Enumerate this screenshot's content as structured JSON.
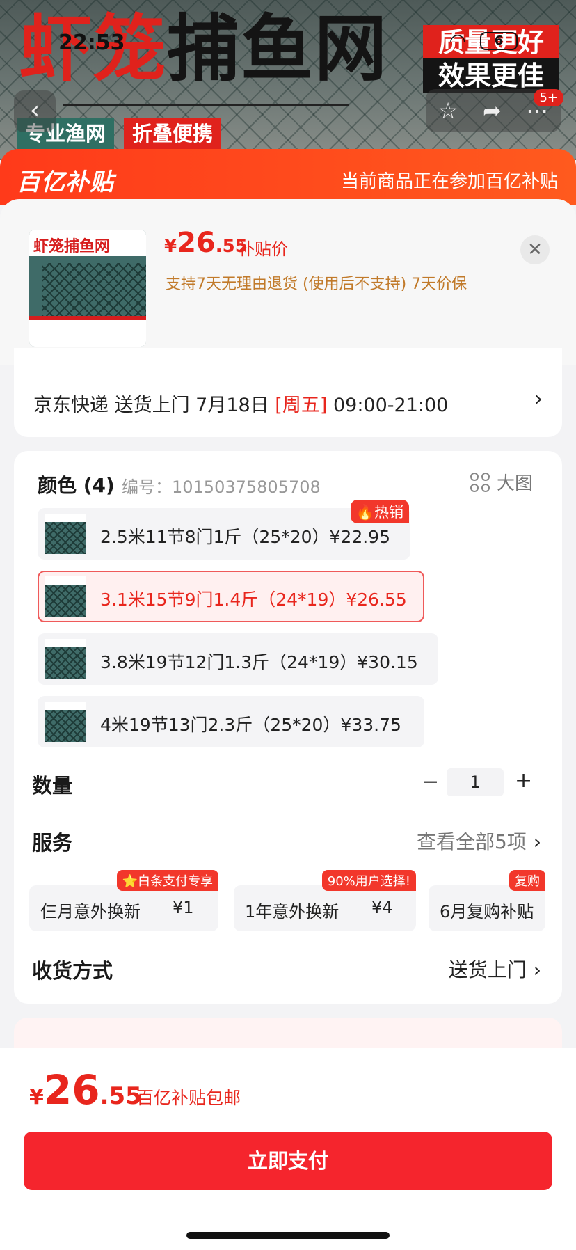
{
  "status_bar": {
    "time": "22:53",
    "battery": "6"
  },
  "hero": {
    "title_red": "虾笼",
    "title_black": "捕鱼网",
    "badge_1": "质量更好",
    "badge_2": "效果更佳",
    "tag_1": "专业渔网",
    "tag_2": "折叠便携",
    "notification_count": "5+"
  },
  "subsidy_bar": {
    "logo": "百亿补贴",
    "note": "当前商品正在参加百亿补贴"
  },
  "product": {
    "price_currency": "¥",
    "price_int": "26",
    "price_dec": ".55",
    "price_label": "补贴价",
    "services": "支持7天无理由退货 (使用后不支持)  7天价保",
    "thumb_title": "虾笼捕鱼网"
  },
  "delivery": {
    "text_before": "京东快递 送货上门 7月18日 ",
    "day": "[周五]",
    "time_range": " 09:00-21:00"
  },
  "spec": {
    "title": "颜色 (4)",
    "code": "编号：10150375805708",
    "big_image": "大图",
    "options": [
      {
        "label": "2.5米11节8门1斤（25*20）¥22.95",
        "badge": "🔥热销"
      },
      {
        "label": "3.1米15节9门1.4斤（24*19）¥26.55"
      },
      {
        "label": "3.8米19节12门1.3斤（24*19）¥30.15"
      },
      {
        "label": "4米19节13门2.3斤（25*20）¥33.75"
      }
    ]
  },
  "quantity": {
    "label": "数量",
    "minus": "−",
    "value": "1",
    "plus": "+"
  },
  "service": {
    "label": "服务",
    "view_all": "查看全部5项",
    "cards": [
      {
        "name": "仨月意外换新",
        "price": "¥1",
        "tag": "⭐白条支付专享"
      },
      {
        "name": "1年意外换新",
        "price": "¥4",
        "tag": "90%用户选择!"
      },
      {
        "name": "6月复购补贴",
        "price": "",
        "tag": "复购"
      }
    ]
  },
  "receive": {
    "label": "收货方式",
    "value": "送货上门"
  },
  "bottom": {
    "price_currency": "¥",
    "price_int": "26",
    "price_dec": ".55",
    "price_label": "百亿补贴包邮",
    "pay_button": "立即支付"
  },
  "colors": {
    "accent": "#e8261d",
    "subsidy": "#ff4a1c",
    "pay_button": "#f5252d"
  }
}
